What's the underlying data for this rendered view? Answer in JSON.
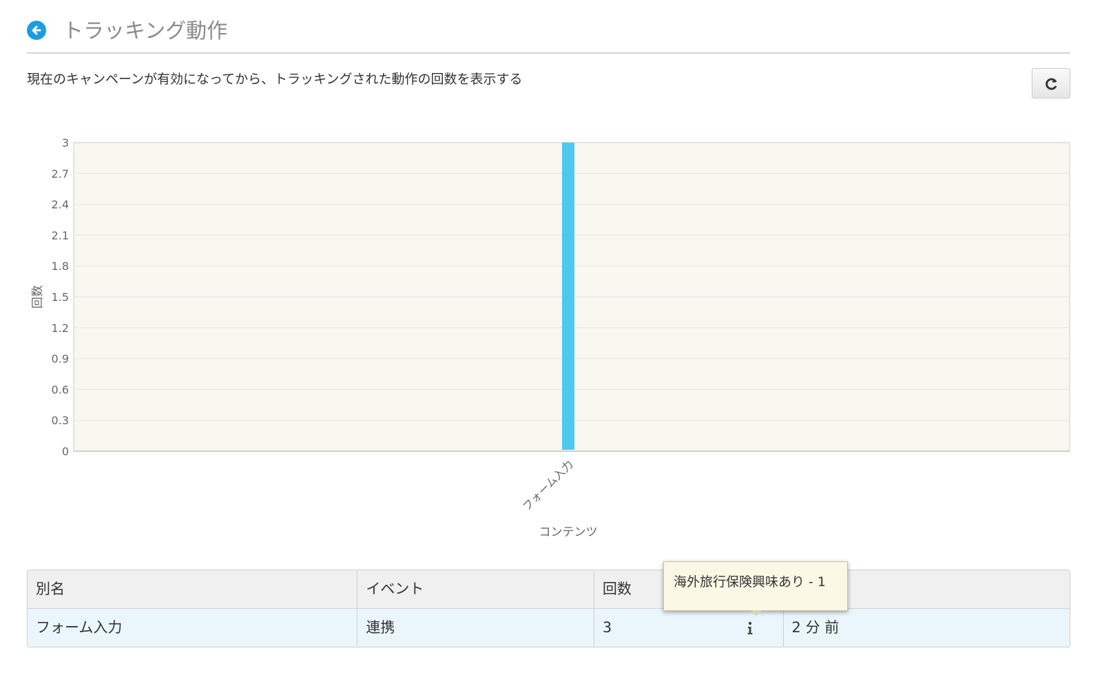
{
  "header": {
    "title": "トラッキング動作",
    "back_icon": "arrow-left-circle-icon"
  },
  "description": "現在のキャンペーンが有効になってから、トラッキングされた動作の回数を表示する",
  "refresh_icon": "refresh-icon",
  "colors": {
    "accent": "#1a9ee0",
    "bar": "#4fc8f0",
    "plot_bg": "#f8f7f0",
    "row_highlight": "#eaf6fb"
  },
  "chart_data": {
    "type": "bar",
    "categories": [
      "フォーム入力"
    ],
    "values": [
      3
    ],
    "xlabel": "コンテンツ",
    "ylabel": "回数",
    "ylim": [
      0,
      3
    ],
    "yticks": [
      "0",
      "0.3",
      "0.6",
      "0.9",
      "1.2",
      "1.5",
      "1.8",
      "2.1",
      "2.4",
      "2.7",
      "3"
    ],
    "grid": true
  },
  "table": {
    "headers": [
      "別名",
      "イベント",
      "回数",
      "更新日"
    ],
    "rows": [
      {
        "alias": "フォーム入力",
        "event": "連携",
        "count": "3",
        "updated": "2 分 前"
      }
    ]
  },
  "tooltip": {
    "text": "海外旅行保険興味あり - 1"
  },
  "info_icon": "info-icon"
}
